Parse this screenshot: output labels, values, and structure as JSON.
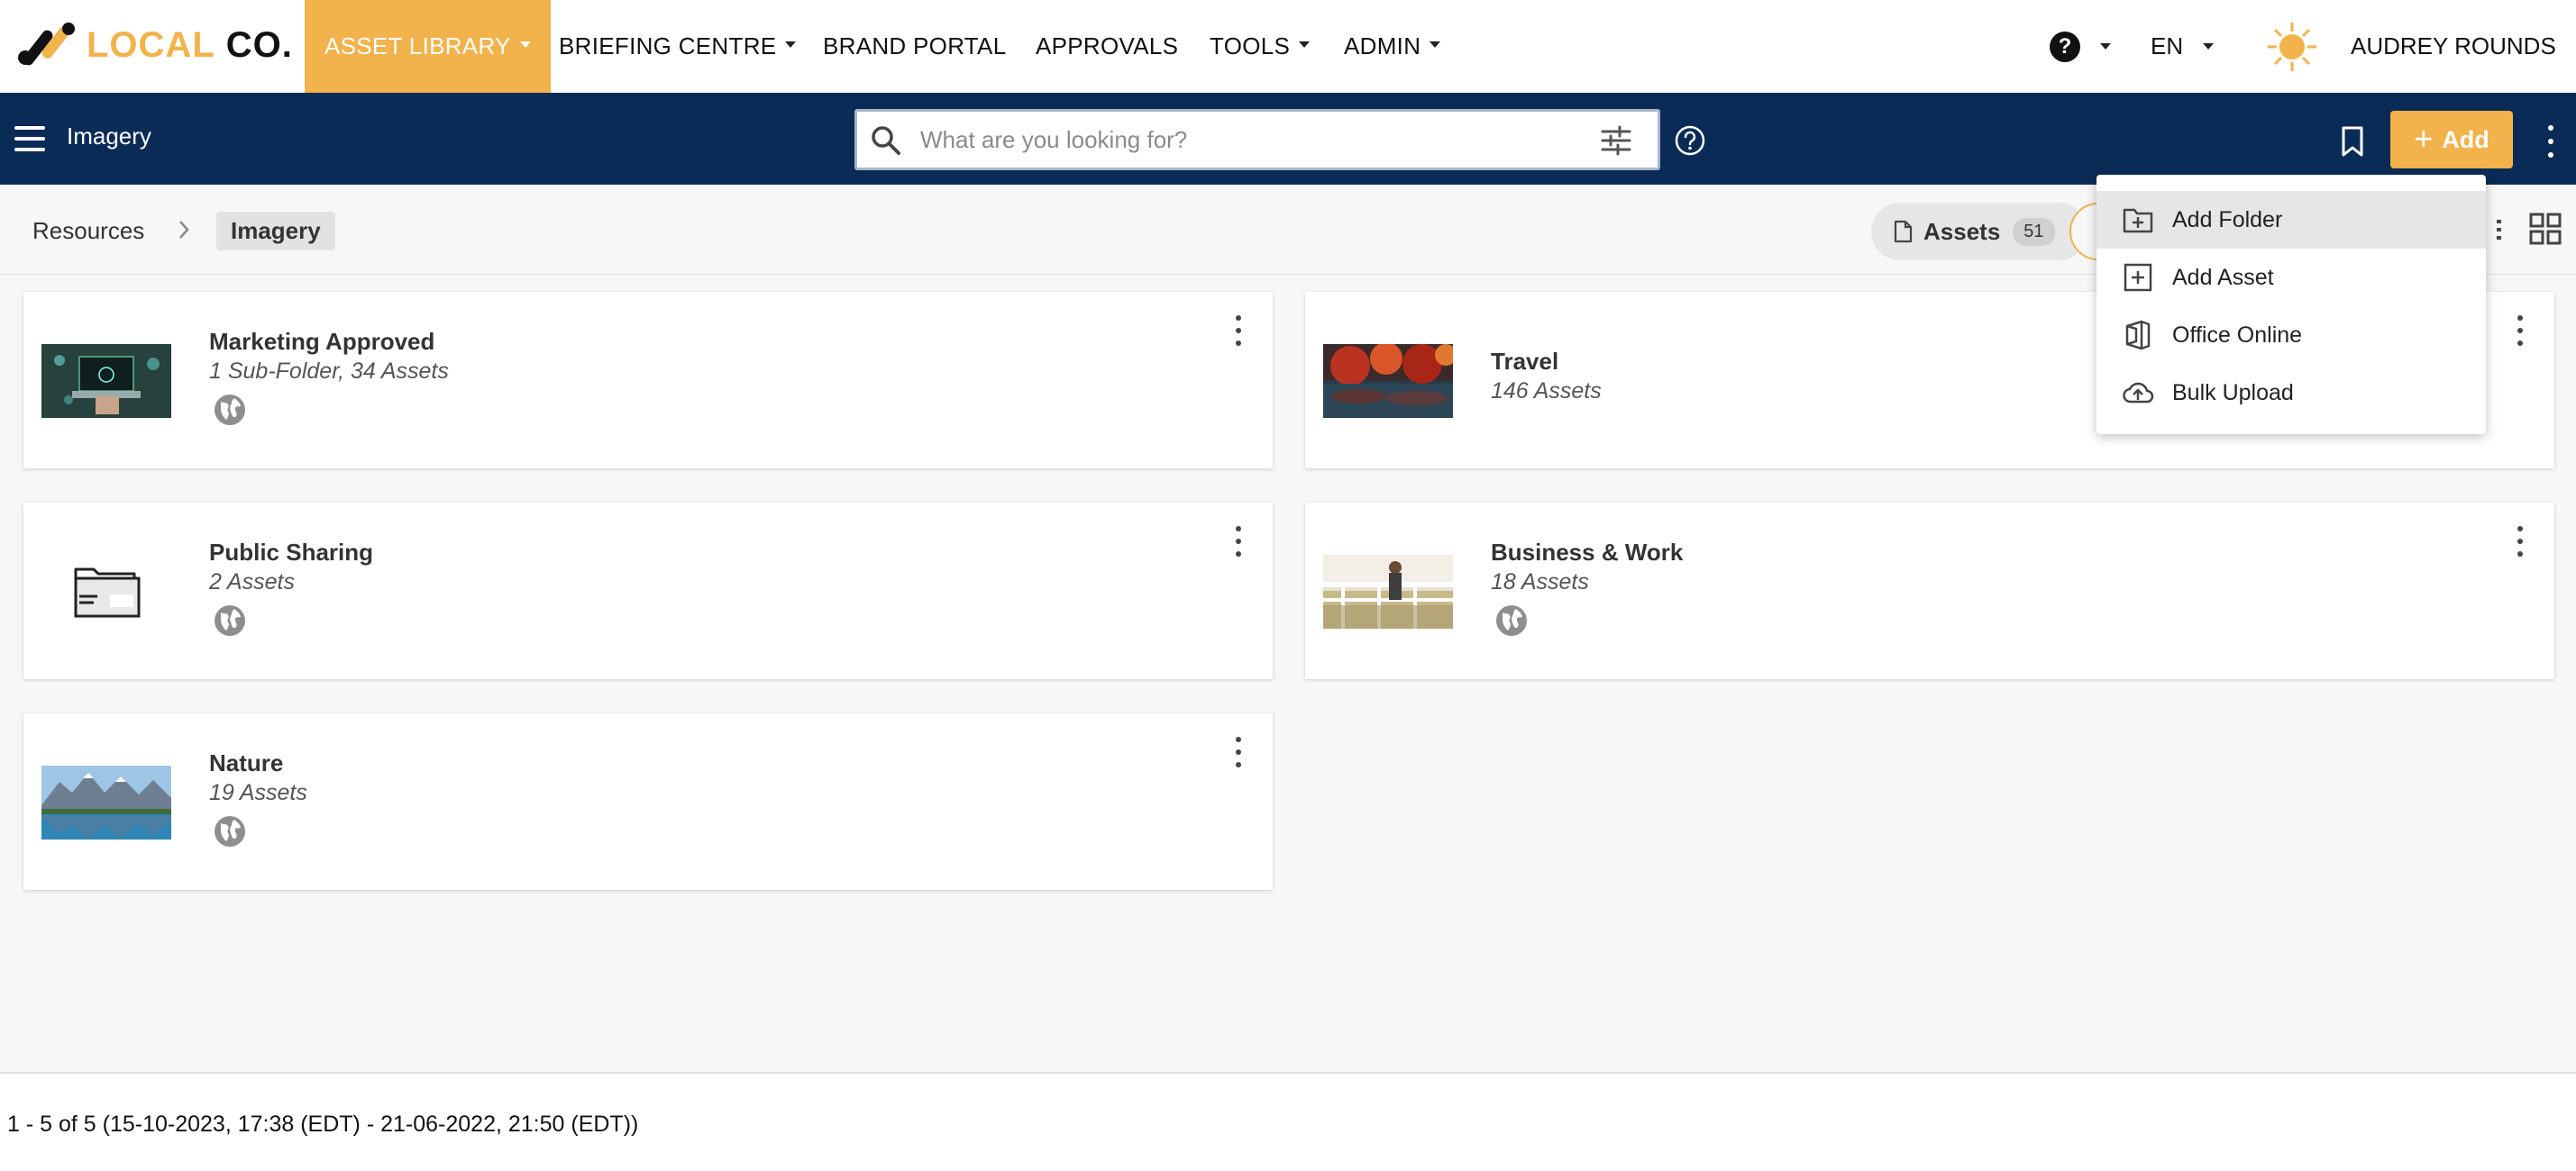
{
  "brand": {
    "local": "LOCAL",
    "co": "CO.",
    "accent": "#f2b24c",
    "navy": "#0b2b57"
  },
  "nav": {
    "items": [
      {
        "label": "ASSET LIBRARY",
        "dropdown": true,
        "active": true
      },
      {
        "label": "BRIEFING CENTRE",
        "dropdown": true
      },
      {
        "label": "BRAND PORTAL",
        "dropdown": false
      },
      {
        "label": "APPROVALS",
        "dropdown": false
      },
      {
        "label": "TOOLS",
        "dropdown": true
      },
      {
        "label": "ADMIN",
        "dropdown": true
      }
    ],
    "help_glyph": "?",
    "language": "EN",
    "user_name": "AUDREY ROUNDS"
  },
  "subbar": {
    "title": "Imagery",
    "search_placeholder": "What are you looking for?",
    "add_label": "Add"
  },
  "breadcrumb": {
    "root": "Resources",
    "current": "Imagery"
  },
  "view": {
    "assets_label": "Assets",
    "assets_count": "51"
  },
  "dropdown": {
    "items": [
      {
        "label": "Add Folder",
        "icon": "folder-plus-icon"
      },
      {
        "label": "Add Asset",
        "icon": "square-plus-icon"
      },
      {
        "label": "Office Online",
        "icon": "office-icon"
      },
      {
        "label": "Bulk Upload",
        "icon": "cloud-upload-icon"
      }
    ]
  },
  "folders": [
    {
      "name": "Marketing Approved",
      "meta": "1 Sub-Folder, 34 Assets",
      "public": true
    },
    {
      "name": "Travel",
      "meta": "146 Assets",
      "public": false
    },
    {
      "name": "Public Sharing",
      "meta": "2 Assets",
      "public": true
    },
    {
      "name": "Business & Work",
      "meta": "18 Assets",
      "public": true
    },
    {
      "name": "Nature",
      "meta": "19 Assets",
      "public": true
    }
  ],
  "footer": {
    "range": "1 - 5 of 5 (15-10-2023, 17:38 (EDT) - 21-06-2022, 21:50 (EDT))"
  }
}
